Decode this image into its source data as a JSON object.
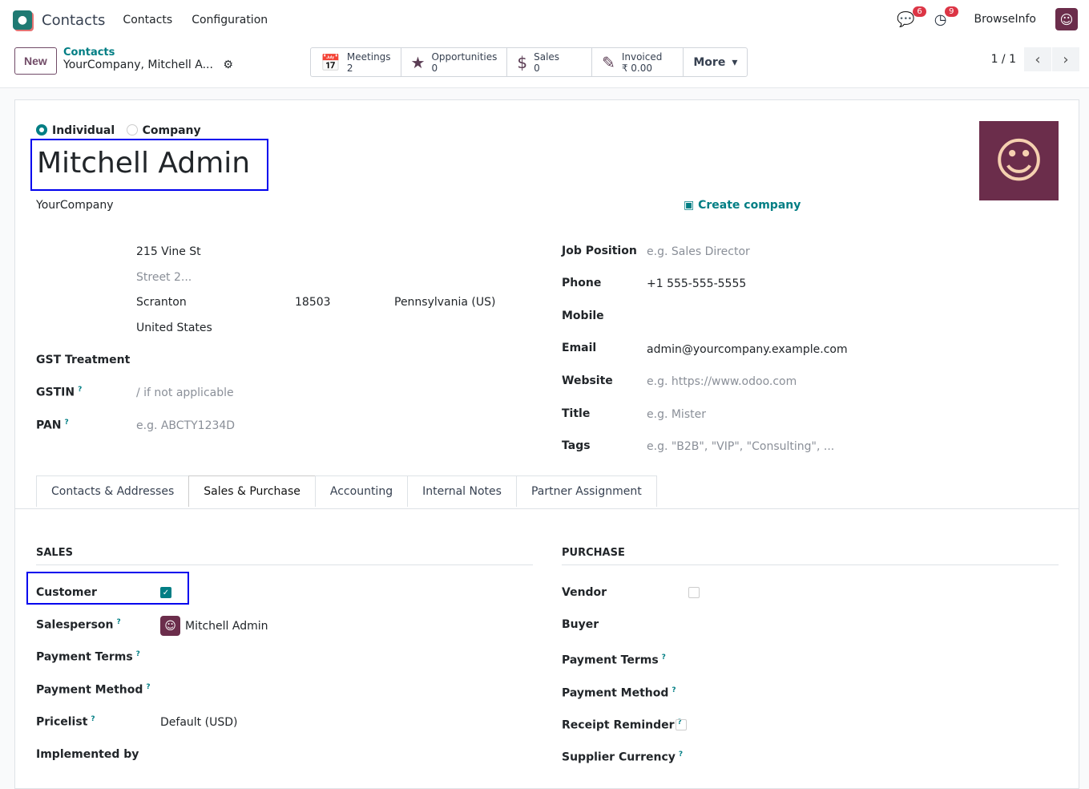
{
  "nav": {
    "app": "Contacts",
    "menus": [
      "Contacts",
      "Configuration"
    ],
    "messages_count": "6",
    "activities_count": "9",
    "user": "BrowseInfo"
  },
  "control": {
    "new": "New",
    "breadcrumb": "Contacts",
    "record": "YourCompany, Mitchell A...",
    "stats": [
      {
        "label": "Meetings",
        "value": "2"
      },
      {
        "label": "Opportunities",
        "value": "0"
      },
      {
        "label": "Sales",
        "value": "0"
      },
      {
        "label": "Invoiced",
        "value": "₹ 0.00"
      }
    ],
    "more": "More",
    "pager": "1 / 1"
  },
  "form": {
    "type_individual": "Individual",
    "type_company": "Company",
    "name": "Mitchell Admin",
    "company": "YourCompany",
    "create_company": "Create company",
    "street": "215 Vine St",
    "street2": "Street 2...",
    "city": "Scranton",
    "zip": "18503",
    "state": "Pennsylvania (US)",
    "country": "United States",
    "gst_label": "GST Treatment",
    "gstin_label": "GSTIN",
    "gstin_ph": "/ if not applicable",
    "pan_label": "PAN",
    "pan_ph": "e.g. ABCTY1234D",
    "job_label": "Job Position",
    "job_ph": "e.g. Sales Director",
    "phone_label": "Phone",
    "phone": "+1 555-555-5555",
    "mobile_label": "Mobile",
    "email_label": "Email",
    "email": "admin@yourcompany.example.com",
    "website_label": "Website",
    "website_ph": "e.g. https://www.odoo.com",
    "title_label": "Title",
    "title_ph": "e.g. Mister",
    "tags_label": "Tags",
    "tags_ph": "e.g. \"B2B\", \"VIP\", \"Consulting\", ..."
  },
  "tabs": [
    "Contacts & Addresses",
    "Sales & Purchase",
    "Accounting",
    "Internal Notes",
    "Partner Assignment"
  ],
  "sales": {
    "title": "SALES",
    "customer": "Customer",
    "customer_checked": true,
    "salesperson": "Salesperson",
    "salesperson_value": "Mitchell Admin",
    "payment_terms": "Payment Terms",
    "payment_method": "Payment Method",
    "pricelist": "Pricelist",
    "pricelist_value": "Default (USD)",
    "implemented_by": "Implemented by"
  },
  "purchase": {
    "title": "PURCHASE",
    "vendor": "Vendor",
    "buyer": "Buyer",
    "payment_terms": "Payment Terms",
    "payment_method": "Payment Method",
    "receipt_reminder": "Receipt Reminder",
    "supplier_currency": "Supplier Currency"
  },
  "help_mark": "?"
}
